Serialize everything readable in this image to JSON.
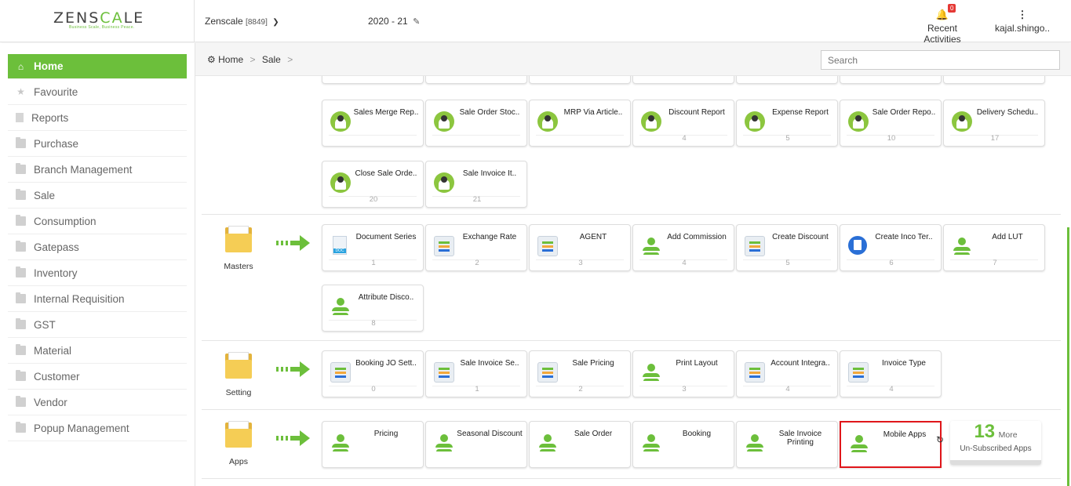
{
  "header": {
    "logo": "ZENSCALE",
    "logo_tagline": "Business Scale, Business Peace.",
    "company": "Zenscale",
    "company_code": "[8849]",
    "year": "2020 - 21",
    "activities_label": "Recent Activities",
    "activities_count": "0",
    "user": "kajal.shingo.."
  },
  "sidebar": {
    "items": [
      {
        "label": "Home",
        "icon": "home-icon"
      },
      {
        "label": "Favourite",
        "icon": "star-icon"
      },
      {
        "label": "Reports",
        "icon": "document-icon"
      },
      {
        "label": "Purchase",
        "icon": "folder-icon"
      },
      {
        "label": "Branch Management",
        "icon": "folder-icon"
      },
      {
        "label": "Sale",
        "icon": "folder-icon"
      },
      {
        "label": "Consumption",
        "icon": "folder-icon"
      },
      {
        "label": "Gatepass",
        "icon": "folder-icon"
      },
      {
        "label": "Inventory",
        "icon": "folder-icon"
      },
      {
        "label": "Internal Requisition",
        "icon": "folder-icon"
      },
      {
        "label": "GST",
        "icon": "folder-icon"
      },
      {
        "label": "Material",
        "icon": "folder-icon"
      },
      {
        "label": "Customer",
        "icon": "folder-icon"
      },
      {
        "label": "Vendor",
        "icon": "folder-icon"
      },
      {
        "label": "Popup Management",
        "icon": "folder-icon"
      }
    ]
  },
  "breadcrumb": {
    "home": "Home",
    "current": "Sale"
  },
  "search": {
    "placeholder": "Search"
  },
  "reports_row1": [
    {
      "title": "Sales Merge Rep..",
      "num": ""
    },
    {
      "title": "Sale Order Stoc..",
      "num": ""
    },
    {
      "title": "MRP Via Article..",
      "num": ""
    },
    {
      "title": "Discount Report",
      "num": "4"
    },
    {
      "title": "Expense Report",
      "num": "5"
    },
    {
      "title": "Sale Order Repo..",
      "num": "10"
    },
    {
      "title": "Delivery Schedu..",
      "num": "17"
    }
  ],
  "reports_row2": [
    {
      "title": "Close Sale Orde..",
      "num": "20"
    },
    {
      "title": "Sale Invoice It..",
      "num": "21"
    }
  ],
  "masters": {
    "label": "Masters",
    "cards": [
      {
        "title": "Document Series",
        "num": "1"
      },
      {
        "title": "Exchange Rate",
        "num": "2"
      },
      {
        "title": "AGENT",
        "num": "3"
      },
      {
        "title": "Add Commission",
        "num": "4"
      },
      {
        "title": "Create Discount",
        "num": "5"
      },
      {
        "title": "Create Inco Ter..",
        "num": "6"
      },
      {
        "title": "Add LUT",
        "num": "7"
      },
      {
        "title": "Attribute Disco..",
        "num": "8"
      }
    ]
  },
  "setting": {
    "label": "Setting",
    "cards": [
      {
        "title": "Booking JO Sett..",
        "num": "0"
      },
      {
        "title": "Sale Invoice Se..",
        "num": "1"
      },
      {
        "title": "Sale Pricing",
        "num": "2"
      },
      {
        "title": "Print Layout",
        "num": "3"
      },
      {
        "title": "Account Integra..",
        "num": "4"
      },
      {
        "title": "Invoice Type",
        "num": "4"
      }
    ]
  },
  "apps": {
    "label": "Apps",
    "cards": [
      {
        "title": "Pricing"
      },
      {
        "title": "Seasonal Discount"
      },
      {
        "title": "Sale Order"
      },
      {
        "title": "Booking"
      },
      {
        "title": "Sale Invoice Printing"
      },
      {
        "title": "Mobile Apps"
      }
    ],
    "more_count": "13",
    "more_label": "More",
    "unsubscribed_label": "Un-Subscribed Apps"
  },
  "colors": {
    "accent": "#6cbf3b",
    "selected_border": "#e0161b"
  }
}
